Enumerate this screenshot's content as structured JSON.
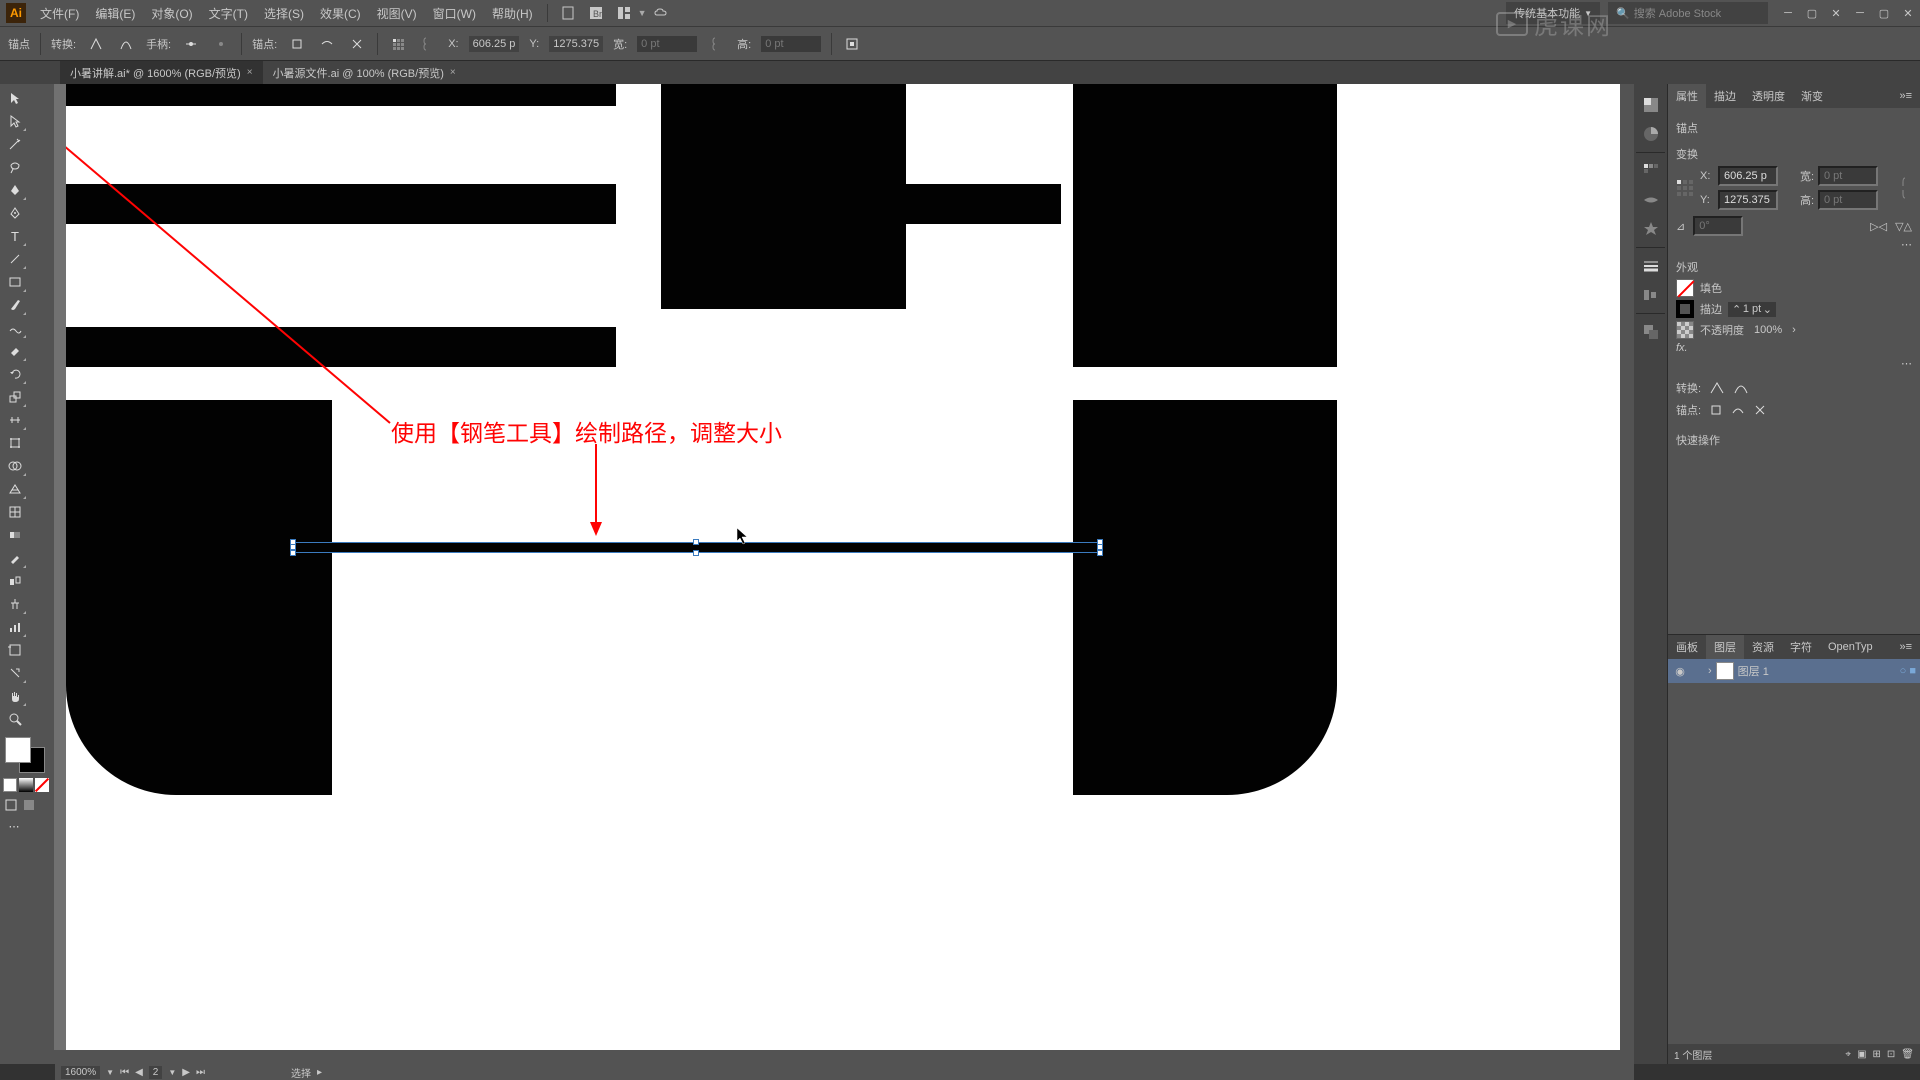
{
  "app_logo": "Ai",
  "menus": {
    "file": "文件(F)",
    "edit": "编辑(E)",
    "object": "对象(O)",
    "type": "文字(T)",
    "select": "选择(S)",
    "effect": "效果(C)",
    "view": "视图(V)",
    "window": "窗口(W)",
    "help": "帮助(H)"
  },
  "workspace": "传统基本功能",
  "search_placeholder": "搜索 Adobe Stock",
  "controlbar": {
    "anchor": "锚点",
    "convert": "转换:",
    "handle": "手柄:",
    "anchors_lbl": "锚点:",
    "x_lbl": "X:",
    "y_lbl": "Y:",
    "x_val": "606.25 p",
    "y_val": "1275.375",
    "w_lbl": "宽:",
    "h_lbl": "高:",
    "w_val": "0 pt",
    "h_val": "0 pt"
  },
  "tabs": {
    "active": "小暑讲解.ai* @ 1600% (RGB/预览)",
    "inactive": "小暑源文件.ai @ 100% (RGB/预览)"
  },
  "annotation": "使用【钢笔工具】绘制路径，调整大小",
  "properties": {
    "tabs": {
      "props": "属性",
      "stroke": "描边",
      "transparency": "透明度",
      "gradient": "渐变"
    },
    "anchor_title": "锚点",
    "transform_title": "变换",
    "x_lbl": "X:",
    "y_lbl": "Y:",
    "w_lbl": "宽:",
    "h_lbl": "高:",
    "x_val": "606.25 p",
    "y_val": "1275.375",
    "w_val": "0 pt",
    "h_val": "0 pt",
    "angle_val": "0°",
    "appearance_title": "外观",
    "fill": "填色",
    "stroke_lbl": "描边",
    "stroke_val": "1 pt",
    "opacity_lbl": "不透明度",
    "opacity_val": "100%",
    "fx": "fx.",
    "convert_title": "转换:",
    "anchors_title": "锚点:",
    "quick_title": "快速操作"
  },
  "layers": {
    "tabs": {
      "artboards": "画板",
      "layers": "图层",
      "assets": "资源",
      "glyphs": "字符",
      "opentype": "OpenTyp"
    },
    "layer1": "图层 1",
    "footer": "1 个图层"
  },
  "status": {
    "zoom": "1600%",
    "artboard": "2",
    "tool": "选择"
  },
  "watermark": "虎课网"
}
